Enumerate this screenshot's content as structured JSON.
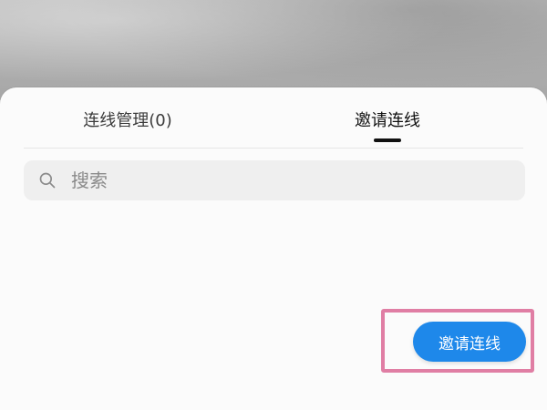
{
  "tabs": {
    "items": [
      {
        "label": "连线管理(0)"
      },
      {
        "label": "邀请连线"
      }
    ]
  },
  "search": {
    "placeholder": "搜索"
  },
  "actions": {
    "invite_label": "邀请连线"
  },
  "colors": {
    "primary_blue": "#1e88ea",
    "highlight_pink": "#e07ea4",
    "sheet_bg": "#fbfbfb",
    "search_bg": "#efefef"
  },
  "icons": {
    "search": "search-icon"
  }
}
